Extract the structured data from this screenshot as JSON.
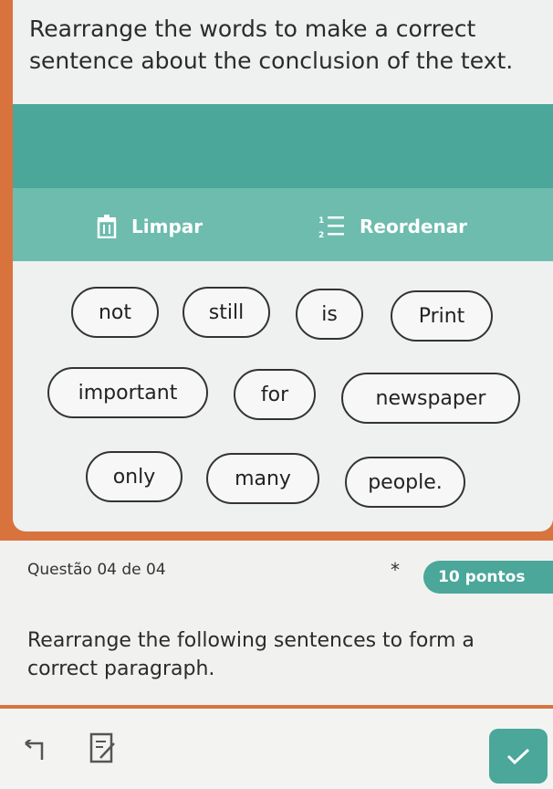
{
  "question": {
    "prompt": "Rearrange the words to make a correct sentence about the conclusion of the text."
  },
  "toolbar": {
    "clear_label": "Limpar",
    "clear_icon": "trash-icon",
    "reorder_label": "Reordenar",
    "reorder_icon": "numbered-list-icon"
  },
  "word_bank": {
    "words": [
      "not",
      "still",
      "is",
      "Print",
      "important",
      "for",
      "newspaper",
      "only",
      "many",
      "people."
    ]
  },
  "next_question": {
    "label": "Questão 04 de 04",
    "required_marker": "*",
    "points": "10 pontos",
    "instruction": "Rearrange the following sentences to form a correct paragraph."
  },
  "footer": {
    "back_icon": "back-arrow-icon",
    "notes_icon": "edit-note-icon",
    "confirm_icon": "check-icon"
  },
  "colors": {
    "background": "#d8733e",
    "accent": "#4aa79a",
    "toolbar": "#6dbcae"
  }
}
